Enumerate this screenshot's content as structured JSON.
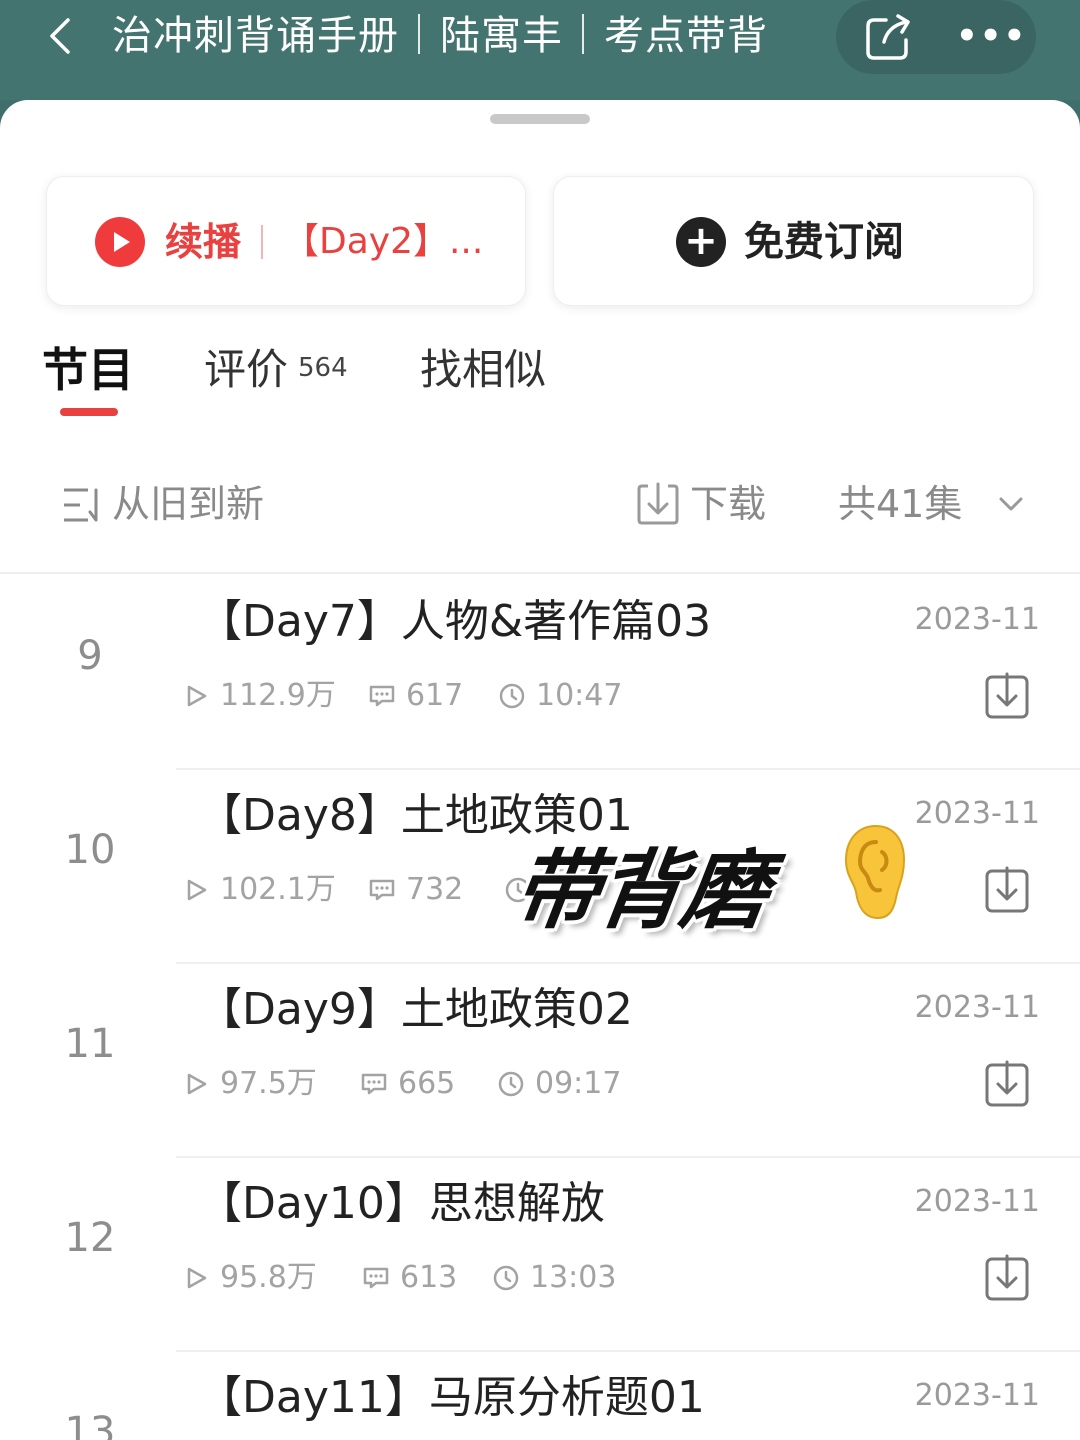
{
  "header": {
    "title": "治冲刺背诵手册｜陆寓丰｜考点带背",
    "back_icon": "chevron-left-icon",
    "share_icon": "share-icon",
    "more_label": "•••"
  },
  "actions": {
    "resume_label": "续播",
    "resume_episode": "【Day2】...",
    "subscribe_plus": "+",
    "subscribe_label": "免费订阅"
  },
  "tabs": [
    {
      "label": "节目",
      "active": true
    },
    {
      "label": "评价",
      "count": "564"
    },
    {
      "label": "找相似"
    }
  ],
  "toolbar": {
    "sort_label": "从旧到新",
    "download_label": "下载",
    "episodes_label": "共41集"
  },
  "episodes": [
    {
      "num": "9",
      "title": "【Day7】人物&著作篇03",
      "date": "2023-11",
      "plays": "112.9万",
      "comments": "617",
      "duration": "10:47"
    },
    {
      "num": "10",
      "title": "【Day8】土地政策01",
      "date": "2023-11",
      "plays": "102.1万",
      "comments": "732",
      "duration": ""
    },
    {
      "num": "11",
      "title": "【Day9】土地政策02",
      "date": "2023-11",
      "plays": "97.5万",
      "comments": "665",
      "duration": "09:17"
    },
    {
      "num": "12",
      "title": "【Day10】思想解放",
      "date": "2023-11",
      "plays": "95.8万",
      "comments": "613",
      "duration": "13:03"
    },
    {
      "num": "13",
      "title": "【Day11】马原分析题01",
      "date": "2023-11",
      "plays": "",
      "comments": "",
      "duration": ""
    }
  ],
  "sticker": {
    "text": "带背磨",
    "emoji_icon": "ear-emoji-icon"
  },
  "colors": {
    "header_bg": "#437470",
    "accent_red": "#e8413f",
    "muted_text": "#9a9a9a"
  }
}
